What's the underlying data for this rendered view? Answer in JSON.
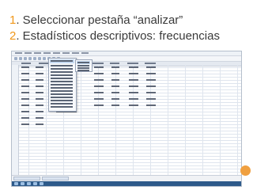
{
  "slide": {
    "line1_num": "1",
    "line1_text": ". Seleccionar pestaña “analizar”",
    "line2_num": "2",
    "line2_text": ". Estadísticos descriptivos: frecuencias",
    "accent_color": "#f0971a"
  },
  "screenshot": {
    "window": "spss-data-editor",
    "open_menu": "analizar",
    "highlighted_item": "estadisticos-descriptivos",
    "highlighted_submenu_item": "frecuencias"
  }
}
